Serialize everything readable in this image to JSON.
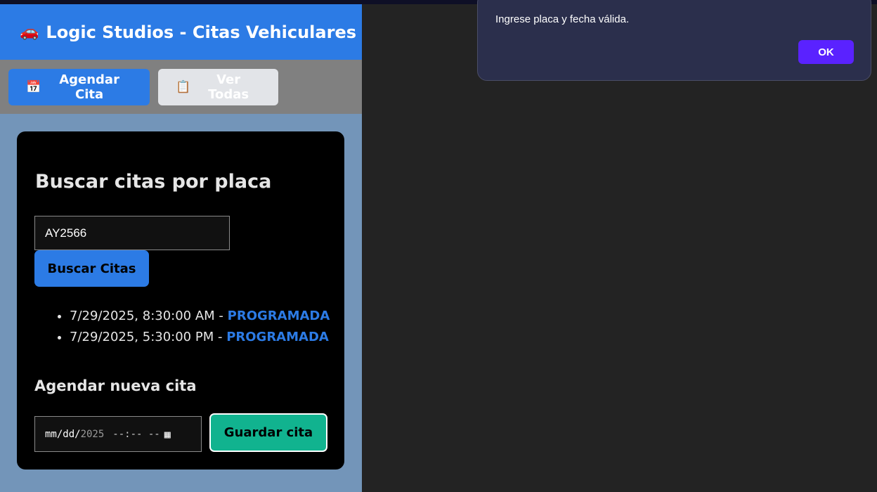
{
  "header": {
    "icon": "car-icon",
    "icon_glyph": "🚗",
    "title": "Logic Studios - Citas Vehiculares"
  },
  "nav": {
    "schedule": {
      "icon": "calendar-icon",
      "icon_glyph": "📅",
      "label": "Agendar Cita"
    },
    "view_all": {
      "icon": "clipboard-icon",
      "icon_glyph": "📋",
      "label": "Ver Todas"
    }
  },
  "search": {
    "heading": "Buscar citas por placa",
    "plate_value": "AY2566",
    "button_label": "Buscar Citas",
    "results": [
      {
        "datetime": "7/29/2025, 8:30:00 AM",
        "sep": " - ",
        "status": "PROGRAMADA"
      },
      {
        "datetime": "7/29/2025, 5:30:00 PM",
        "sep": " - ",
        "status": "PROGRAMADA"
      }
    ]
  },
  "new_appointment": {
    "heading": "Agendar nueva cita",
    "date_month_day": "mm/dd/",
    "date_year": "2025",
    "time_placeholder": "--:-- --",
    "calendar_icon": "calendar-picker-icon",
    "save_label": "Guardar cita"
  },
  "dialog": {
    "message": "Ingrese placa y fecha válida.",
    "ok_label": "OK"
  },
  "colors": {
    "primary": "#2c7be5",
    "success": "#11b38f",
    "dialog_accent": "#5a22ff"
  }
}
